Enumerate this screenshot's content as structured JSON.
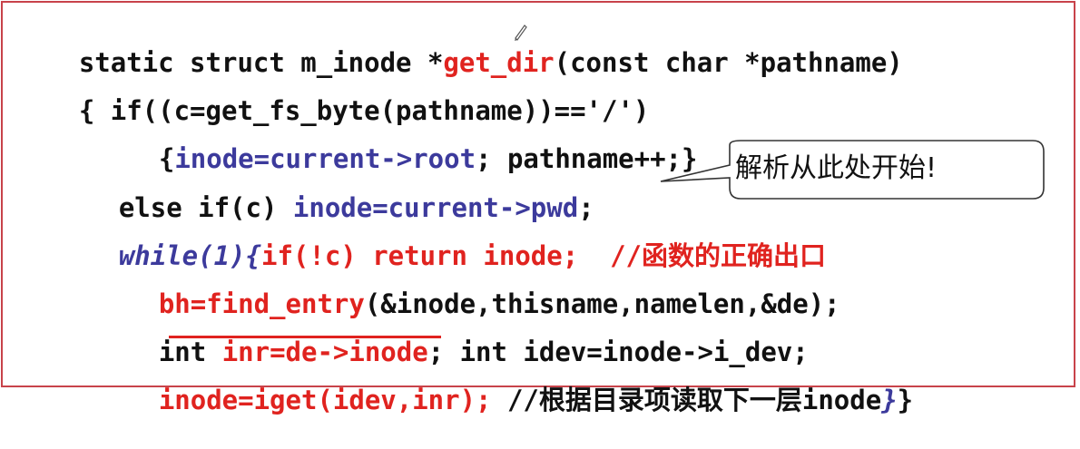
{
  "code": {
    "l1": {
      "a": "static struct m_inode *",
      "b": "get_dir",
      "c": "(const char *pathname)"
    },
    "l2": "{ if((c=get_fs_byte(pathname))=='/')",
    "l3": {
      "a": "{",
      "b": "inode=current->root",
      "c": "; pathname++;}"
    },
    "l4": {
      "a": "else if(c) ",
      "b": "inode=current->pwd",
      "c": ";"
    },
    "l5": {
      "a": "while(1){",
      "b": "if(!c) return inode;  //函数的正确出口"
    },
    "l6": {
      "a": "bh=find_entry",
      "b": "(&inode,thisname,namelen,&de);"
    },
    "l7": {
      "a": "int ",
      "b": "inr=de->inode",
      "c": "; int idev=inode->i_dev;"
    },
    "l8": {
      "a": "inode=iget(idev,inr);",
      "b": " //根据目录项读取下一层inode",
      "c": "}",
      "d": "}"
    }
  },
  "callout": {
    "text": "解析从此处开始!"
  },
  "colors": {
    "frame": "#c8434a",
    "keyword_blue": "#3c3a9c",
    "highlight_red": "#e0231f",
    "text": "#111111"
  },
  "icons": {
    "cursor": "pencil-cursor-icon"
  }
}
